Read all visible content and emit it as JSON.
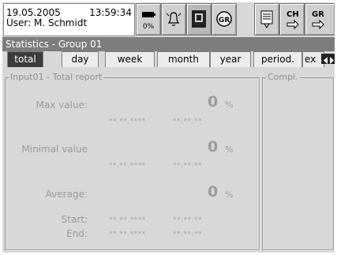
{
  "header": {
    "date": "19.05.2005",
    "time": "13:59:34",
    "user": "User: M. Schmidt",
    "battery_percent": "0%",
    "icons": [
      "battery-icon",
      "alarm-bell-icon",
      "display-icon",
      "gr-icon",
      "print-icon",
      "ch-switch-icon",
      "gr-switch-icon"
    ],
    "ch_label": "CH",
    "gr_label": "GR"
  },
  "title": "Statistics - Group 01",
  "tabs": [
    "total",
    "day",
    "week",
    "month",
    "year",
    "period.",
    "ex"
  ],
  "active_tab": "total",
  "input_panel": {
    "title": "Input01 - Total report",
    "max_label": "Max value:",
    "max_value": "0",
    "max_unit": "%",
    "max_date": "**.**.****",
    "max_time": "**:**:**",
    "min_label": "Minimal value",
    "min_value": "0",
    "min_unit": "%",
    "min_date": "**.**.****",
    "min_time": "**:**:**",
    "avg_label": "Average:",
    "avg_value": "0",
    "avg_unit": "%",
    "start_label": "Start:",
    "start_date": "**.**.****",
    "start_time": "**:**:**",
    "end_label": "End:",
    "end_date": "**.**.****",
    "end_time": "**:**:**"
  },
  "compl_panel": {
    "title": "Compl."
  }
}
